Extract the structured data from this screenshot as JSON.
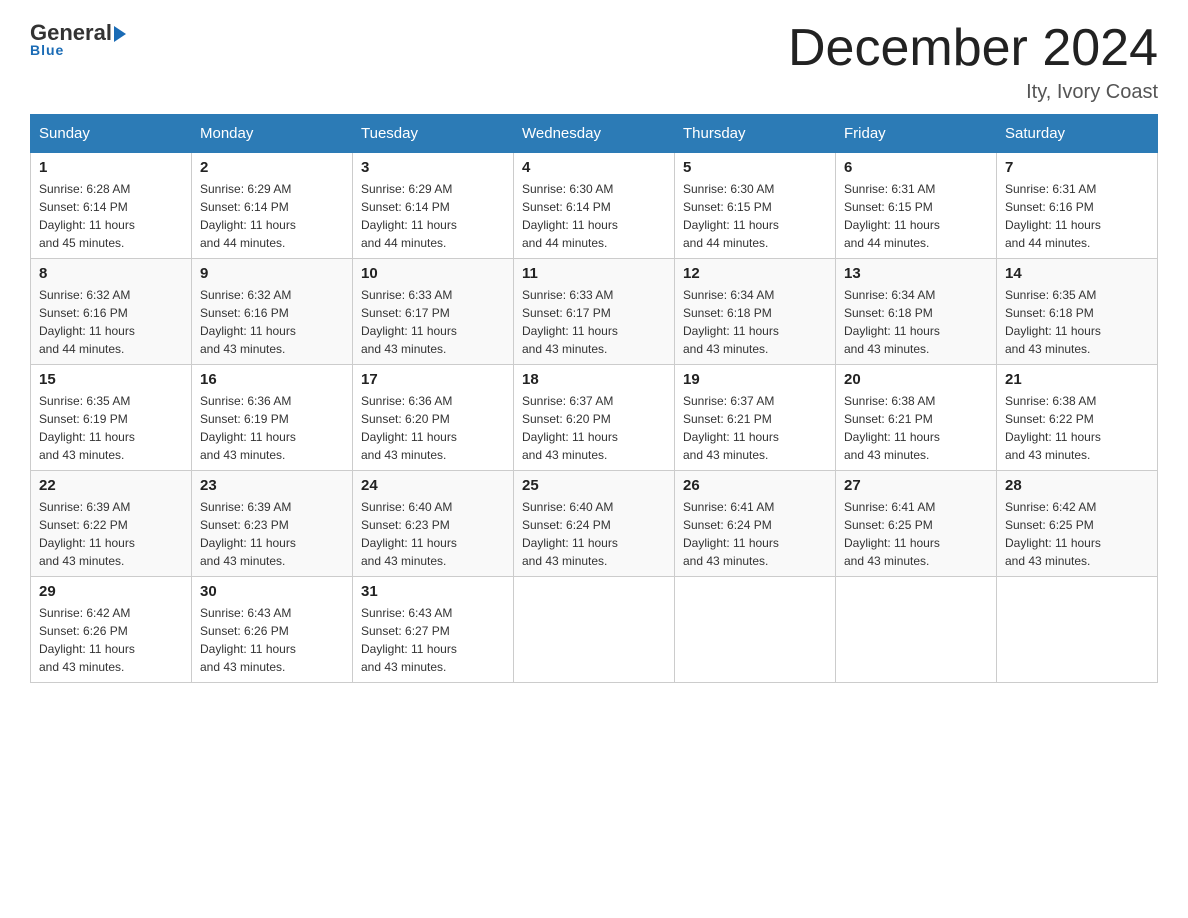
{
  "logo": {
    "general": "General",
    "blue": "Blue",
    "underline": "Blue"
  },
  "title": "December 2024",
  "location": "Ity, Ivory Coast",
  "days_of_week": [
    "Sunday",
    "Monday",
    "Tuesday",
    "Wednesday",
    "Thursday",
    "Friday",
    "Saturday"
  ],
  "weeks": [
    [
      {
        "day": "1",
        "sunrise": "6:28 AM",
        "sunset": "6:14 PM",
        "daylight": "11 hours and 45 minutes."
      },
      {
        "day": "2",
        "sunrise": "6:29 AM",
        "sunset": "6:14 PM",
        "daylight": "11 hours and 44 minutes."
      },
      {
        "day": "3",
        "sunrise": "6:29 AM",
        "sunset": "6:14 PM",
        "daylight": "11 hours and 44 minutes."
      },
      {
        "day": "4",
        "sunrise": "6:30 AM",
        "sunset": "6:14 PM",
        "daylight": "11 hours and 44 minutes."
      },
      {
        "day": "5",
        "sunrise": "6:30 AM",
        "sunset": "6:15 PM",
        "daylight": "11 hours and 44 minutes."
      },
      {
        "day": "6",
        "sunrise": "6:31 AM",
        "sunset": "6:15 PM",
        "daylight": "11 hours and 44 minutes."
      },
      {
        "day": "7",
        "sunrise": "6:31 AM",
        "sunset": "6:16 PM",
        "daylight": "11 hours and 44 minutes."
      }
    ],
    [
      {
        "day": "8",
        "sunrise": "6:32 AM",
        "sunset": "6:16 PM",
        "daylight": "11 hours and 44 minutes."
      },
      {
        "day": "9",
        "sunrise": "6:32 AM",
        "sunset": "6:16 PM",
        "daylight": "11 hours and 43 minutes."
      },
      {
        "day": "10",
        "sunrise": "6:33 AM",
        "sunset": "6:17 PM",
        "daylight": "11 hours and 43 minutes."
      },
      {
        "day": "11",
        "sunrise": "6:33 AM",
        "sunset": "6:17 PM",
        "daylight": "11 hours and 43 minutes."
      },
      {
        "day": "12",
        "sunrise": "6:34 AM",
        "sunset": "6:18 PM",
        "daylight": "11 hours and 43 minutes."
      },
      {
        "day": "13",
        "sunrise": "6:34 AM",
        "sunset": "6:18 PM",
        "daylight": "11 hours and 43 minutes."
      },
      {
        "day": "14",
        "sunrise": "6:35 AM",
        "sunset": "6:18 PM",
        "daylight": "11 hours and 43 minutes."
      }
    ],
    [
      {
        "day": "15",
        "sunrise": "6:35 AM",
        "sunset": "6:19 PM",
        "daylight": "11 hours and 43 minutes."
      },
      {
        "day": "16",
        "sunrise": "6:36 AM",
        "sunset": "6:19 PM",
        "daylight": "11 hours and 43 minutes."
      },
      {
        "day": "17",
        "sunrise": "6:36 AM",
        "sunset": "6:20 PM",
        "daylight": "11 hours and 43 minutes."
      },
      {
        "day": "18",
        "sunrise": "6:37 AM",
        "sunset": "6:20 PM",
        "daylight": "11 hours and 43 minutes."
      },
      {
        "day": "19",
        "sunrise": "6:37 AM",
        "sunset": "6:21 PM",
        "daylight": "11 hours and 43 minutes."
      },
      {
        "day": "20",
        "sunrise": "6:38 AM",
        "sunset": "6:21 PM",
        "daylight": "11 hours and 43 minutes."
      },
      {
        "day": "21",
        "sunrise": "6:38 AM",
        "sunset": "6:22 PM",
        "daylight": "11 hours and 43 minutes."
      }
    ],
    [
      {
        "day": "22",
        "sunrise": "6:39 AM",
        "sunset": "6:22 PM",
        "daylight": "11 hours and 43 minutes."
      },
      {
        "day": "23",
        "sunrise": "6:39 AM",
        "sunset": "6:23 PM",
        "daylight": "11 hours and 43 minutes."
      },
      {
        "day": "24",
        "sunrise": "6:40 AM",
        "sunset": "6:23 PM",
        "daylight": "11 hours and 43 minutes."
      },
      {
        "day": "25",
        "sunrise": "6:40 AM",
        "sunset": "6:24 PM",
        "daylight": "11 hours and 43 minutes."
      },
      {
        "day": "26",
        "sunrise": "6:41 AM",
        "sunset": "6:24 PM",
        "daylight": "11 hours and 43 minutes."
      },
      {
        "day": "27",
        "sunrise": "6:41 AM",
        "sunset": "6:25 PM",
        "daylight": "11 hours and 43 minutes."
      },
      {
        "day": "28",
        "sunrise": "6:42 AM",
        "sunset": "6:25 PM",
        "daylight": "11 hours and 43 minutes."
      }
    ],
    [
      {
        "day": "29",
        "sunrise": "6:42 AM",
        "sunset": "6:26 PM",
        "daylight": "11 hours and 43 minutes."
      },
      {
        "day": "30",
        "sunrise": "6:43 AM",
        "sunset": "6:26 PM",
        "daylight": "11 hours and 43 minutes."
      },
      {
        "day": "31",
        "sunrise": "6:43 AM",
        "sunset": "6:27 PM",
        "daylight": "11 hours and 43 minutes."
      },
      null,
      null,
      null,
      null
    ]
  ],
  "labels": {
    "sunrise": "Sunrise:",
    "sunset": "Sunset:",
    "daylight": "Daylight:"
  }
}
